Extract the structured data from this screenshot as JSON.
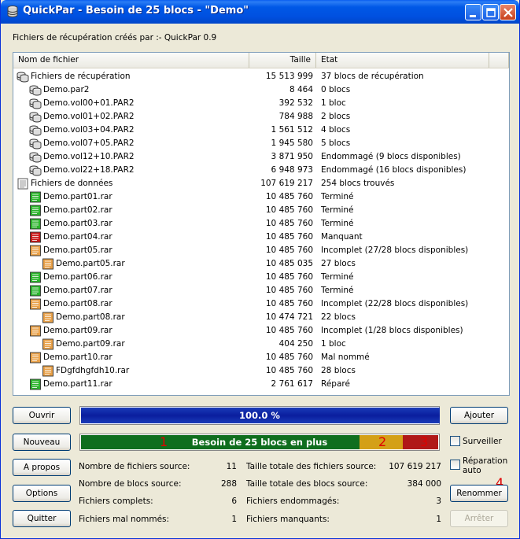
{
  "window": {
    "title": "QuickPar - Besoin de 25 blocs - \"Demo\"",
    "subtitle": "Fichiers de récupération créés par :- QuickPar 0.9"
  },
  "list": {
    "headers": {
      "name": "Nom de fichier",
      "size": "Taille",
      "state": "Etat"
    },
    "rows": [
      {
        "indent": 0,
        "icon": "recovery-group",
        "name": "Fichiers de récupération",
        "size": "15 513 999",
        "state": "37 blocs de récupération"
      },
      {
        "indent": 1,
        "icon": "recovery-file",
        "name": "Demo.par2",
        "size": "8 464",
        "state": "0 blocs"
      },
      {
        "indent": 1,
        "icon": "recovery-file",
        "name": "Demo.vol00+01.PAR2",
        "size": "392 532",
        "state": "1 bloc"
      },
      {
        "indent": 1,
        "icon": "recovery-file",
        "name": "Demo.vol01+02.PAR2",
        "size": "784 988",
        "state": "2 blocs"
      },
      {
        "indent": 1,
        "icon": "recovery-file",
        "name": "Demo.vol03+04.PAR2",
        "size": "1 561 512",
        "state": "4 blocs"
      },
      {
        "indent": 1,
        "icon": "recovery-file",
        "name": "Demo.vol07+05.PAR2",
        "size": "1 945 580",
        "state": "5 blocs"
      },
      {
        "indent": 1,
        "icon": "recovery-file",
        "name": "Demo.vol12+10.PAR2",
        "size": "3 871 950",
        "state": "Endommagé (9 blocs disponibles)"
      },
      {
        "indent": 1,
        "icon": "recovery-file",
        "name": "Demo.vol22+18.PAR2",
        "size": "6 948 973",
        "state": "Endommagé (16 blocs disponibles)"
      },
      {
        "indent": 0,
        "icon": "data-group",
        "name": "Fichiers de données",
        "size": "107 619 217",
        "state": "254 blocs trouvés"
      },
      {
        "indent": 1,
        "icon": "file-ok",
        "name": "Demo.part01.rar",
        "size": "10 485 760",
        "state": "Terminé"
      },
      {
        "indent": 1,
        "icon": "file-ok",
        "name": "Demo.part02.rar",
        "size": "10 485 760",
        "state": "Terminé"
      },
      {
        "indent": 1,
        "icon": "file-ok",
        "name": "Demo.part03.rar",
        "size": "10 485 760",
        "state": "Terminé"
      },
      {
        "indent": 1,
        "icon": "file-missing",
        "name": "Demo.part04.rar",
        "size": "10 485 760",
        "state": "Manquant"
      },
      {
        "indent": 1,
        "icon": "file-partial",
        "name": "Demo.part05.rar",
        "size": "10 485 760",
        "state": "Incomplet (27/28 blocs disponibles)"
      },
      {
        "indent": 2,
        "icon": "file-fragment",
        "name": "Demo.part05.rar",
        "size": "10 485 035",
        "state": "27 blocs"
      },
      {
        "indent": 1,
        "icon": "file-ok",
        "name": "Demo.part06.rar",
        "size": "10 485 760",
        "state": "Terminé"
      },
      {
        "indent": 1,
        "icon": "file-ok",
        "name": "Demo.part07.rar",
        "size": "10 485 760",
        "state": "Terminé"
      },
      {
        "indent": 1,
        "icon": "file-partial",
        "name": "Demo.part08.rar",
        "size": "10 485 760",
        "state": "Incomplet (22/28 blocs disponibles)"
      },
      {
        "indent": 2,
        "icon": "file-fragment",
        "name": "Demo.part08.rar",
        "size": "10 474 721",
        "state": "22 blocs"
      },
      {
        "indent": 1,
        "icon": "file-partial",
        "name": "Demo.part09.rar",
        "size": "10 485 760",
        "state": "Incomplet (1/28 blocs disponibles)"
      },
      {
        "indent": 2,
        "icon": "file-fragment",
        "name": "Demo.part09.rar",
        "size": "404 250",
        "state": "1 bloc"
      },
      {
        "indent": 1,
        "icon": "file-partial",
        "name": "Demo.part10.rar",
        "size": "10 485 760",
        "state": "Mal nommé"
      },
      {
        "indent": 2,
        "icon": "file-fragment",
        "name": "FDgfdhgfdh10.rar",
        "size": "10 485 760",
        "state": "28 blocs"
      },
      {
        "indent": 1,
        "icon": "file-ok",
        "name": "Demo.part11.rar",
        "size": "2 761 617",
        "state": "Réparé"
      }
    ]
  },
  "buttons": {
    "open": "Ouvrir",
    "new": "Nouveau",
    "about": "A propos",
    "options": "Options",
    "quit": "Quitter",
    "add": "Ajouter",
    "rename": "Renommer",
    "stop": "Arrêter"
  },
  "progress": {
    "verify_label": "100.0 %",
    "verify_fraction": 1.0,
    "blocks_label": "Besoin de 25 blocs en plus",
    "segments": [
      {
        "fraction": 0.78,
        "color": "#0f6e1e"
      },
      {
        "fraction": 0.12,
        "color": "#d4a017"
      },
      {
        "fraction": 0.1,
        "color": "#b01818"
      }
    ],
    "markers": [
      "1",
      "2",
      "3",
      "4"
    ]
  },
  "checkboxes": {
    "monitor": "Surveiller",
    "auto_repair": "Réparation auto"
  },
  "stats": {
    "source_files_label": "Nombre de fichiers source:",
    "source_files_value": "11",
    "source_blocks_label": "Nombre de blocs source:",
    "source_blocks_value": "288",
    "complete_files_label": "Fichiers complets:",
    "complete_files_value": "6",
    "misnamed_files_label": "Fichiers mal nommés:",
    "misnamed_files_value": "1",
    "total_source_size_label": "Taille totale des fichiers source:",
    "total_source_size_value": "107 619 217",
    "total_blocks_size_label": "Taille totale des blocs source:",
    "total_blocks_size_value": "384 000",
    "damaged_files_label": "Fichiers endommagés:",
    "damaged_files_value": "3",
    "missing_files_label": "Fichiers manquants:",
    "missing_files_value": "1"
  },
  "colors": {
    "file_ok": "#2bb32b",
    "file_missing": "#c81818",
    "file_partial": "#e8a048",
    "accent": "#0a246a"
  }
}
